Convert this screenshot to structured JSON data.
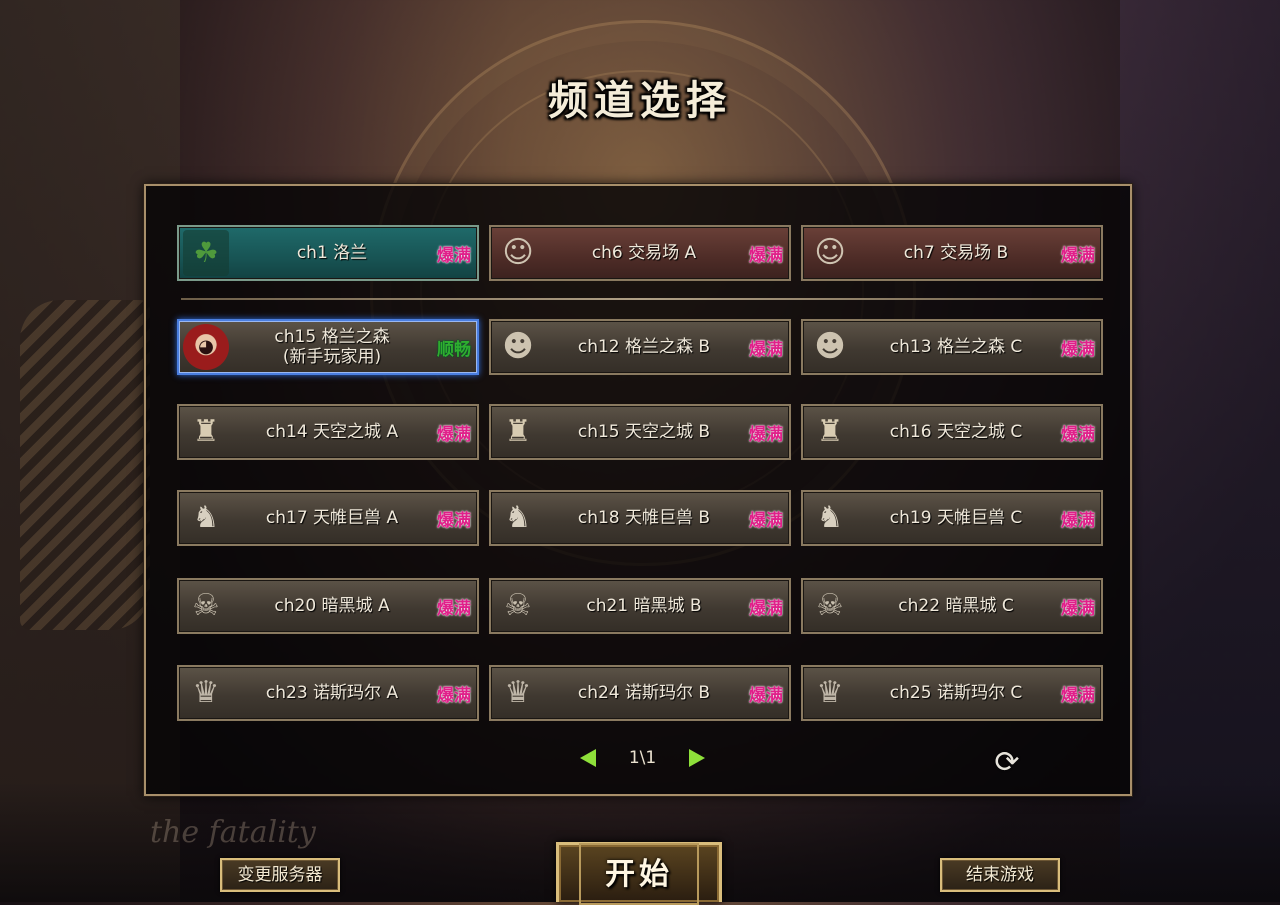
{
  "title": "频道选择",
  "status_labels": {
    "busy": "爆满",
    "smooth": "顺畅"
  },
  "channels_top": [
    {
      "label": "ch1 洛兰",
      "status": "爆满",
      "portrait": "leaf-icon",
      "glyph": "☘"
    },
    {
      "label": "ch6 交易场 A",
      "status": "爆满",
      "portrait": "merchant-icon",
      "glyph": "☺"
    },
    {
      "label": "ch7 交易场 B",
      "status": "爆满",
      "portrait": "merchant-icon",
      "glyph": "☺"
    }
  ],
  "channels": [
    {
      "label": "ch15 格兰之森\n(新手玩家用)",
      "status": "顺畅",
      "portrait": "girl-icon",
      "glyph": "◕",
      "selected": true
    },
    {
      "label": "ch12 格兰之森 B",
      "status": "爆满",
      "portrait": "face-icon",
      "glyph": "☻"
    },
    {
      "label": "ch13 格兰之森 C",
      "status": "爆满",
      "portrait": "face-icon",
      "glyph": "☻"
    },
    {
      "label": "ch14 天空之城 A",
      "status": "爆满",
      "portrait": "statue-icon",
      "glyph": "♜"
    },
    {
      "label": "ch15 天空之城 B",
      "status": "爆满",
      "portrait": "statue-icon",
      "glyph": "♜"
    },
    {
      "label": "ch16 天空之城 C",
      "status": "爆满",
      "portrait": "statue-icon",
      "glyph": "♜"
    },
    {
      "label": "ch17 天帷巨兽 A",
      "status": "爆满",
      "portrait": "mask-icon",
      "glyph": "♞"
    },
    {
      "label": "ch18 天帷巨兽 B",
      "status": "爆满",
      "portrait": "mask-icon",
      "glyph": "♞"
    },
    {
      "label": "ch19 天帷巨兽 C",
      "status": "爆满",
      "portrait": "mask-icon",
      "glyph": "♞"
    },
    {
      "label": "ch20 暗黑城 A",
      "status": "爆满",
      "portrait": "demon-icon",
      "glyph": "☠"
    },
    {
      "label": "ch21 暗黑城 B",
      "status": "爆满",
      "portrait": "demon-icon",
      "glyph": "☠"
    },
    {
      "label": "ch22 暗黑城 C",
      "status": "爆满",
      "portrait": "demon-icon",
      "glyph": "☠"
    },
    {
      "label": "ch23 诺斯玛尔 A",
      "status": "爆满",
      "portrait": "knight-icon",
      "glyph": "♛"
    },
    {
      "label": "ch24 诺斯玛尔 B",
      "status": "爆满",
      "portrait": "knight-icon",
      "glyph": "♛"
    },
    {
      "label": "ch25 诺斯玛尔 C",
      "status": "爆满",
      "portrait": "knight-icon",
      "glyph": "♛"
    }
  ],
  "pager": {
    "page": "1\\1"
  },
  "refresh_glyph": "⟳",
  "buttons": {
    "change_server": "变更服务器",
    "start": "开始",
    "quit": "结束游戏"
  },
  "background_logo": "the fatality"
}
